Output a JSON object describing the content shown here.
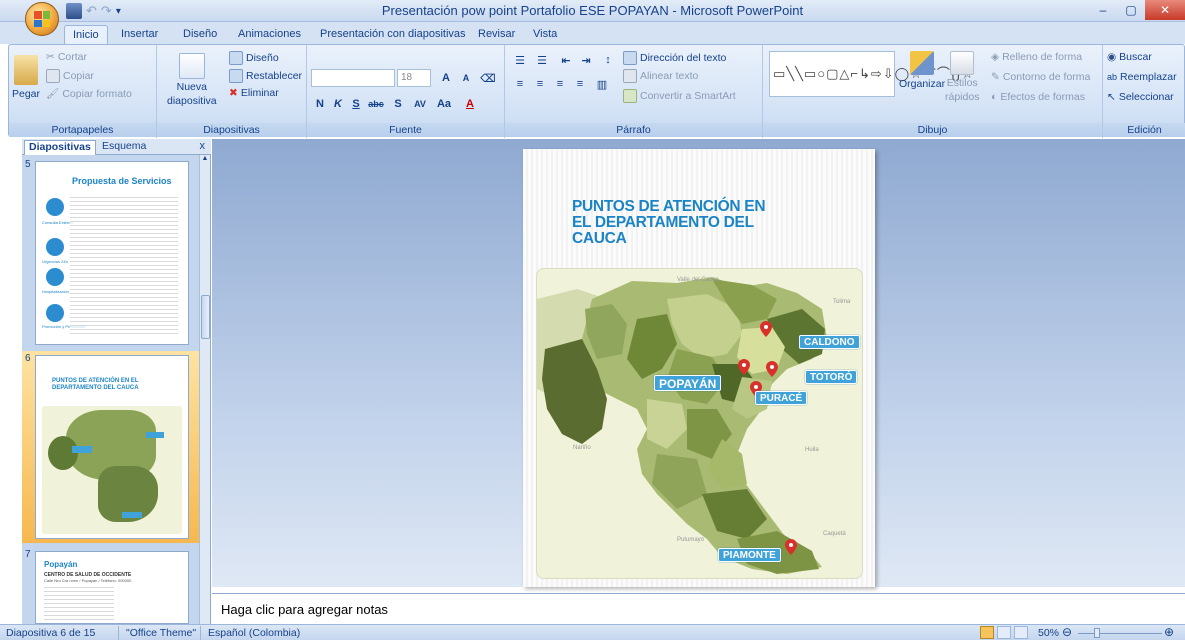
{
  "window": {
    "title": "Presentación pow point Portafolio ESE POPAYAN - Microsoft PowerPoint",
    "minimize": "–",
    "maximize": "▢",
    "close": "✕"
  },
  "tabs": [
    "Inicio",
    "Insertar",
    "Diseño",
    "Animaciones",
    "Presentación con diapositivas",
    "Revisar",
    "Vista"
  ],
  "ribbon": {
    "portapapeles": {
      "label": "Portapapeles",
      "paste": "Pegar",
      "cut": "Cortar",
      "copy": "Copiar",
      "format_painter": "Copiar formato"
    },
    "diapositivas": {
      "label": "Diapositivas",
      "new_slide_1": "Nueva",
      "new_slide_2": "diapositiva",
      "layout": "Diseño",
      "reset": "Restablecer",
      "delete": "Eliminar"
    },
    "fuente": {
      "label": "Fuente",
      "font_size": "18"
    },
    "parrafo": {
      "label": "Párrafo",
      "text_direction": "Dirección del texto",
      "align_text": "Alinear texto",
      "smartart": "Convertir a SmartArt"
    },
    "dibujo": {
      "label": "Dibujo",
      "organize": "Organizar",
      "styles_1": "Estilos",
      "styles_2": "rápidos",
      "fill": "Relleno de forma",
      "outline": "Contorno de forma",
      "effects": "Efectos de formas"
    },
    "edicion": {
      "label": "Edición",
      "find": "Buscar",
      "replace": "Reemplazar",
      "select": "Seleccionar"
    }
  },
  "pane": {
    "tab_slides": "Diapositivas",
    "tab_outline": "Esquema",
    "close": "x",
    "thumbs": [
      {
        "num": "5",
        "title": "Propuesta de Servicios",
        "labels": [
          "Consulta Externa",
          "Urgencias 24h",
          "Hospitalización",
          "Promoción y Prevención"
        ]
      },
      {
        "num": "6",
        "title": "PUNTOS DE ATENCIÓN EN EL DEPARTAMENTO DEL CAUCA"
      },
      {
        "num": "7",
        "title": "Popayán",
        "subtitle": "CENTRO DE SALUD DE OCCIDENTE",
        "subline": "Calle Nro Cra nnnn / Popayán / Teléfono: 000000"
      }
    ]
  },
  "slide": {
    "title": "PUNTOS DE ATENCIÓN EN EL DEPARTAMENTO DEL CAUCA",
    "regions": {
      "valle": "Valle del Cauca",
      "tolima": "Tolima",
      "narino": "Nariño",
      "huila": "Huila",
      "putumayo": "Putumayo",
      "caqueta": "Caquetá"
    },
    "tags": {
      "caldono": "CALDONO",
      "popayan": "POPAYÁN",
      "totoro": "TOTORÓ",
      "purace": "PURACÉ",
      "piamonte": "PIAMONTE"
    }
  },
  "notes": {
    "placeholder": "Haga clic para agregar notas"
  },
  "status": {
    "slide": "Diapositiva 6 de 15",
    "theme": "\"Office Theme\"",
    "language": "Español (Colombia)",
    "zoom": "50%",
    "zoom_out": "⊖",
    "zoom_in": "⊕"
  },
  "colors": {
    "accent_blue": "#1b84c7",
    "tag_blue": "#3fa2d9",
    "pin_red": "#d9302c",
    "selection": "#f6b84e"
  }
}
